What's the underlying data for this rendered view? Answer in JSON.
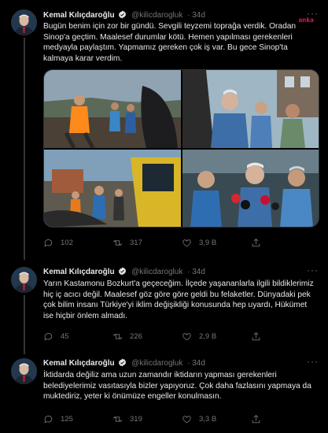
{
  "watermark": "anka",
  "tweets": [
    {
      "author": "Kemal Kılıçdaroğlu",
      "handle": "@kilicdarogluk",
      "time": "· 34d",
      "text": "Bugün benim için zor bir gündü. Sevgili teyzemi toprağa verdik. Oradan Sinop'a geçtim. Maalesef durumlar kötü. Hemen yapılması gerekenleri medyayla paylaştım. Yapmamız gereken çok iş var. Bu gece Sinop'ta kalmaya karar verdim.",
      "replies": "102",
      "retweets": "317",
      "likes": "3,9 B",
      "has_media": true
    },
    {
      "author": "Kemal Kılıçdaroğlu",
      "handle": "@kilicdarogluk",
      "time": "· 34d",
      "text": "Yarın Kastamonu Bozkurt'a geçeceğim. İlçede yaşananlarla ilgili bildiklerimiz hiç iç acıcı değil. Maalesef göz göre göre geldi bu felaketler. Dünyadaki pek çok bilim insanı Türkiye'yi iklim değişikliği konusunda hep uyardı, Hükümet ise hiçbir önlem almadı.",
      "replies": "45",
      "retweets": "226",
      "likes": "2,9 B",
      "has_media": false
    },
    {
      "author": "Kemal Kılıçdaroğlu",
      "handle": "@kilicdarogluk",
      "time": "· 34d",
      "text": "İktidarda değiliz ama uzun zamandır iktidarın yapması gerekenleri belediyelerimiz vasıtasıyla bizler yapıyoruz. Çok daha fazlasını yapmaya da muktediriz, yeter ki önümüze engeller konulmasın.",
      "replies": "125",
      "retweets": "319",
      "likes": "3,3 B",
      "has_media": false
    }
  ],
  "icons": {
    "reply": "reply-icon",
    "retweet": "retweet-icon",
    "like": "heart-icon",
    "share": "share-icon",
    "more": "more-icon",
    "verified": "verified-badge-icon"
  },
  "colors": {
    "background": "#000000",
    "text": "#e7e9ea",
    "secondary": "#71767b",
    "divider": "#2f3336",
    "verified": "#1d9bf0",
    "watermark": "#e0245e"
  }
}
